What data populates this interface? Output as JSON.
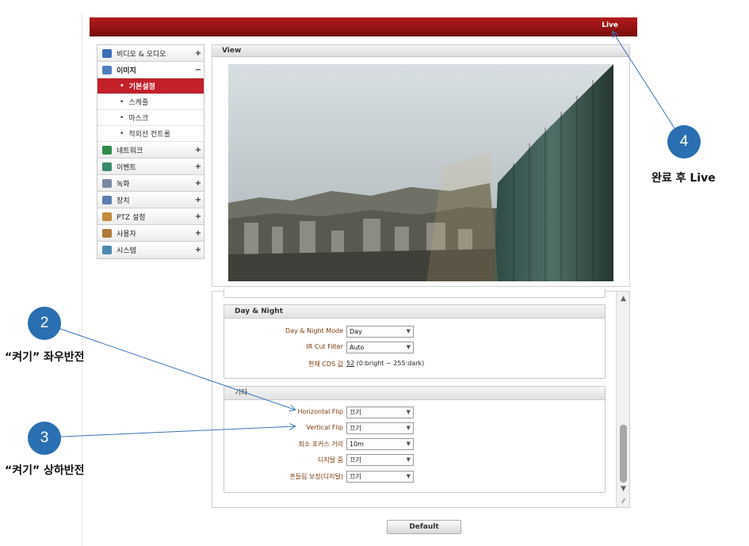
{
  "header": {
    "live_label": "Live"
  },
  "sidebar": {
    "items": [
      {
        "label": "비디오 & 오디오",
        "toggle": "+",
        "icon": "video-audio-icon",
        "color": "#3b6fb6"
      },
      {
        "label": "이미지",
        "toggle": "−",
        "icon": "image-icon",
        "color": "#4d7fc0",
        "children": [
          {
            "label": "기본설정",
            "active": true
          },
          {
            "label": "스케줄"
          },
          {
            "label": "마스크"
          },
          {
            "label": "적외선 컨트롤"
          }
        ]
      },
      {
        "label": "네트워크",
        "toggle": "+",
        "icon": "network-icon",
        "color": "#2f8a4a"
      },
      {
        "label": "이벤트",
        "toggle": "+",
        "icon": "event-icon",
        "color": "#3a8a6a"
      },
      {
        "label": "녹화",
        "toggle": "+",
        "icon": "record-icon",
        "color": "#7a8aa0"
      },
      {
        "label": "장치",
        "toggle": "+",
        "icon": "device-icon",
        "color": "#5a7fb0"
      },
      {
        "label": "PTZ 설정",
        "toggle": "+",
        "icon": "ptz-icon",
        "color": "#c48a3a"
      },
      {
        "label": "사용자",
        "toggle": "+",
        "icon": "user-icon",
        "color": "#b07a3a"
      },
      {
        "label": "시스템",
        "toggle": "+",
        "icon": "system-icon",
        "color": "#4a8ab0"
      }
    ]
  },
  "view": {
    "title": "View"
  },
  "day_night": {
    "title": "Day & Night",
    "mode_label": "Day & Night Mode",
    "mode_value": "Day",
    "ircut_label": "IR Cut Filter",
    "ircut_value": "Auto",
    "cds_label": "현재 CDS 값",
    "cds_value": "52",
    "cds_note": "(0:bright ~ 255:dark)"
  },
  "other": {
    "title": "기타",
    "hflip_label": "Horizontal Flip",
    "hflip_value": "끄기",
    "vflip_label": "Vertical Flip",
    "vflip_value": "끄기",
    "focus_label": "최소 포커스 거리",
    "focus_value": "10m",
    "dzoom_label": "디지털 줌",
    "dzoom_value": "끄기",
    "stab_label": "흔들림 보정(디지털)",
    "stab_value": "끄기"
  },
  "default_button": "Default",
  "annotations": {
    "n2": "2",
    "n2_text": "“켜기” 좌우반전",
    "n3": "3",
    "n3_text": "“켜기” 상하반전",
    "n4": "4",
    "n4_text": "완료 후 Live",
    "circle_color": "#2a6fb1"
  }
}
